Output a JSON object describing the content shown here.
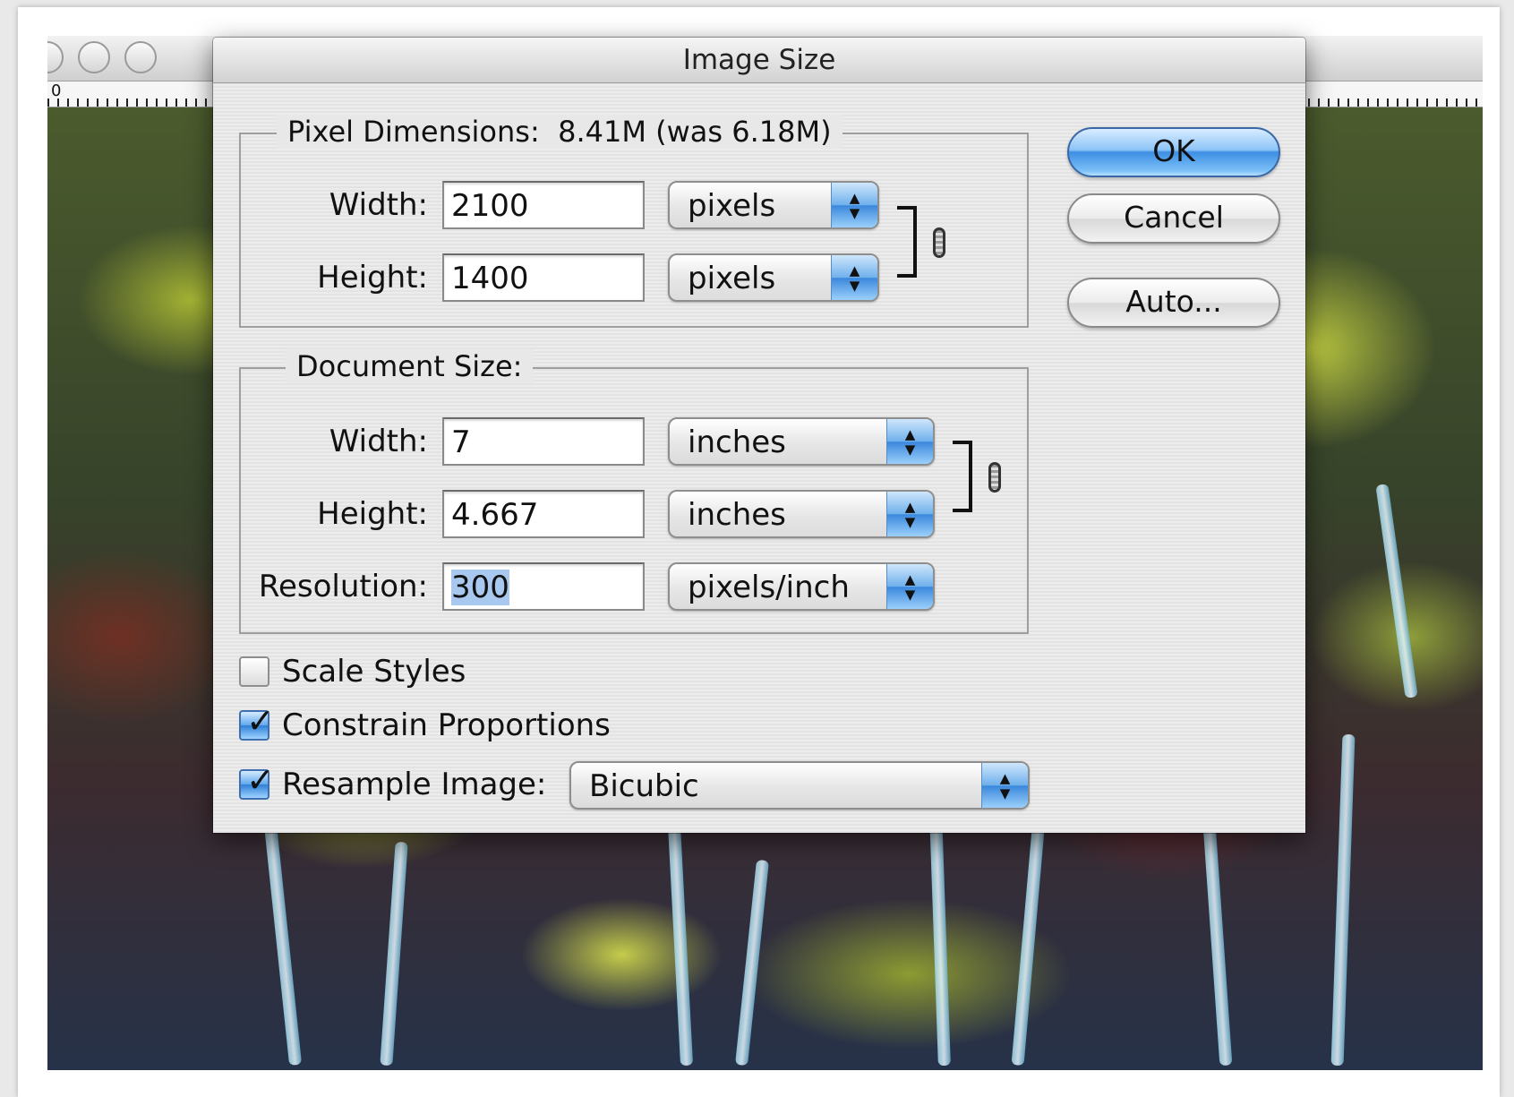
{
  "dialog": {
    "title": "Image Size",
    "pixel_dimensions": {
      "legend_label": "Pixel Dimensions:",
      "legend_value": "8.41M (was 6.18M)",
      "width_label": "Width:",
      "width_value": "2100",
      "width_unit": "pixels",
      "height_label": "Height:",
      "height_value": "1400",
      "height_unit": "pixels"
    },
    "document_size": {
      "legend_label": "Document Size:",
      "width_label": "Width:",
      "width_value": "7",
      "width_unit": "inches",
      "height_label": "Height:",
      "height_value": "4.667",
      "height_unit": "inches",
      "resolution_label": "Resolution:",
      "resolution_value": "300",
      "resolution_unit": "pixels/inch"
    },
    "options": {
      "scale_styles_label": "Scale Styles",
      "scale_styles_checked": false,
      "constrain_label": "Constrain Proportions",
      "constrain_checked": true,
      "resample_label": "Resample Image:",
      "resample_checked": true,
      "resample_method": "Bicubic"
    },
    "buttons": {
      "ok": "OK",
      "cancel": "Cancel",
      "auto": "Auto..."
    }
  },
  "document_window": {
    "ruler_zero": "0"
  },
  "colors": {
    "accent_blue": "#3e8fe4",
    "selection": "#a8c8f0"
  }
}
